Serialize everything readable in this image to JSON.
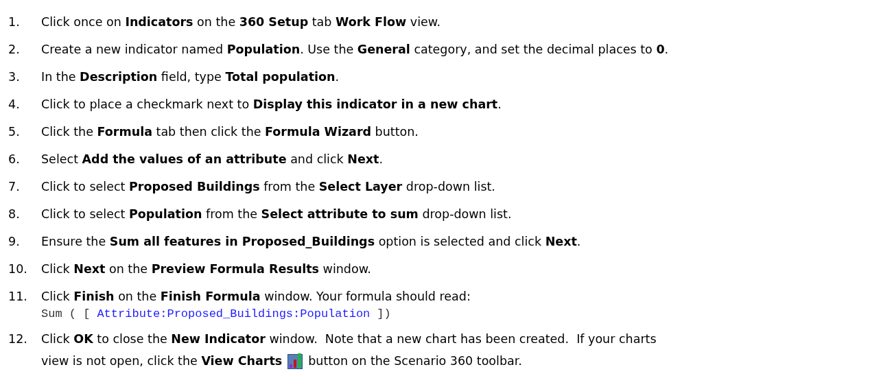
{
  "steps": [
    {
      "number": "1.",
      "text": "Click once on **Indicators** on the **360 Setup** tab **Work Flow** view."
    },
    {
      "number": "2.",
      "text": "Create a new indicator named **Population**. Use the **General** category, and set the decimal places to **0**."
    },
    {
      "number": "3.",
      "text": "In the **Description** field, type **Total population**."
    },
    {
      "number": "4.",
      "text": "Click to place a checkmark next to **Display this indicator in a new chart**."
    },
    {
      "number": "5.",
      "text": "Click the **Formula** tab then click the **Formula Wizard** button."
    },
    {
      "number": "6.",
      "text": "Select **Add the values of an attribute** and click **Next**."
    },
    {
      "number": "7.",
      "text": "Click to select **Proposed Buildings** from the **Select Layer** drop-down list."
    },
    {
      "number": "8.",
      "text": "Click to select **Population** from the **Select attribute to sum** drop-down list."
    },
    {
      "number": "9.",
      "text": "Ensure the **Sum all features in Proposed_Buildings** option is selected and click **Next**."
    },
    {
      "number": "10.",
      "text": "Click **Next** on the **Preview Formula Results** window."
    },
    {
      "number": "11.",
      "text": "Click **Finish** on the **Finish Formula** window. Your formula should read:",
      "formula": {
        "prefix": "Sum ( [",
        "reference": "Attribute:Proposed_Buildings:Population",
        "suffix": "])"
      }
    },
    {
      "number": "12.",
      "text": "Click **OK** to close the **New Indicator** window.  Note that a new chart has been created.  If your charts",
      "continuation": {
        "before_icon": "view is not open, click the **View Charts**",
        "after_icon": "button on the Scenario 360 toolbar."
      }
    }
  ]
}
